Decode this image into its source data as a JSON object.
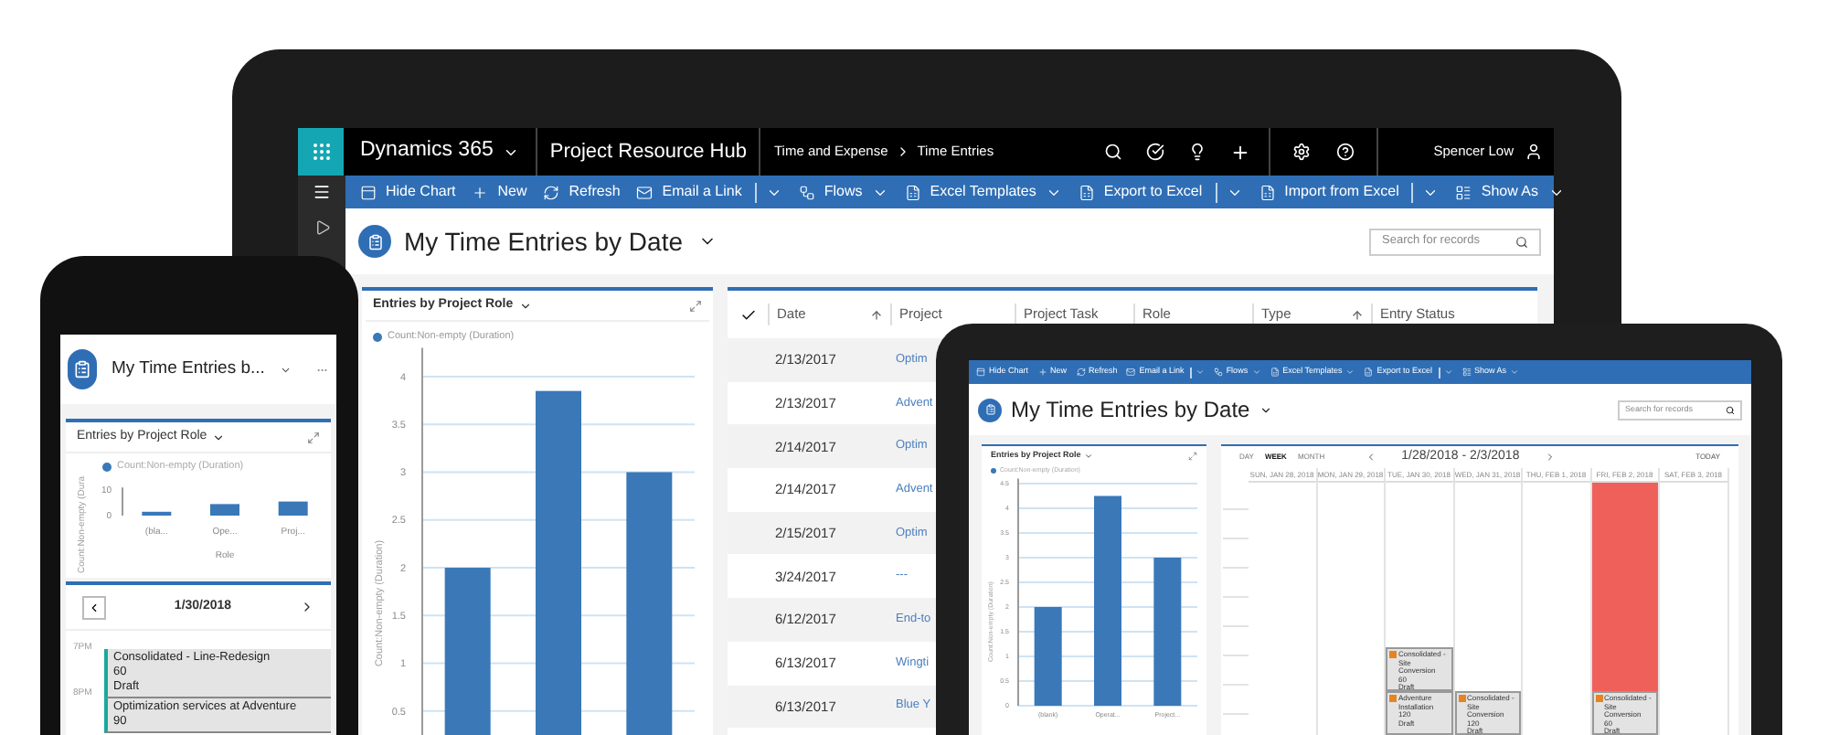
{
  "laptop": {
    "app_bar": {
      "app_name": "Dynamics 365",
      "app_area": "Project Resource Hub",
      "breadcrumb": [
        "Time and Expense",
        "Time Entries"
      ],
      "user": "Spencer Low"
    },
    "command_bar": [
      {
        "label": "Hide Chart",
        "kind": "button"
      },
      {
        "label": "New",
        "kind": "button"
      },
      {
        "label": "Refresh",
        "kind": "button"
      },
      {
        "label": "Email a Link",
        "kind": "split"
      },
      {
        "label": "Flows",
        "kind": "dropdown"
      },
      {
        "label": "Excel Templates",
        "kind": "dropdown"
      },
      {
        "label": "Export to Excel",
        "kind": "split"
      },
      {
        "label": "Import from Excel",
        "kind": "split"
      },
      {
        "label": "Show As",
        "kind": "dropdown"
      }
    ],
    "view": {
      "title": "My Time Entries by Date",
      "search_placeholder": "Search for records"
    },
    "chart": {
      "title": "Entries by Project Role",
      "chart_data": {
        "type": "bar",
        "grid": true,
        "ylabel": "Count:Non-empty (Duration)",
        "ylim": [
          0.25,
          4.3
        ],
        "yticks": [
          0.5,
          1,
          1.5,
          2,
          2.5,
          3,
          3.5,
          4
        ],
        "series": [
          {
            "name": "Count:Non-empty (Duration)",
            "color": "#3a78b8",
            "values": [
              2,
              3.85,
              3
            ]
          }
        ]
      }
    },
    "grid": {
      "columns": [
        {
          "label": "Date",
          "sorted": true
        },
        {
          "label": "Project",
          "sorted": false
        },
        {
          "label": "Project Task",
          "sorted": false
        },
        {
          "label": "Role",
          "sorted": false
        },
        {
          "label": "Type",
          "sorted": true
        },
        {
          "label": "Entry Status",
          "sorted": false
        }
      ],
      "rows": [
        {
          "date": "2/13/2017",
          "project": "Optim"
        },
        {
          "date": "2/13/2017",
          "project": "Advent"
        },
        {
          "date": "2/14/2017",
          "project": "Optim"
        },
        {
          "date": "2/14/2017",
          "project": "Advent"
        },
        {
          "date": "2/15/2017",
          "project": "Optim"
        },
        {
          "date": "3/24/2017",
          "project": "---"
        },
        {
          "date": "6/12/2017",
          "project": "End-to"
        },
        {
          "date": "6/13/2017",
          "project": "Wingti"
        },
        {
          "date": "6/13/2017",
          "project": "Blue Y"
        }
      ]
    }
  },
  "phone": {
    "title": "My Time Entries b...",
    "chart": {
      "title": "Entries by Project Role",
      "chart_data": {
        "type": "bar",
        "grid": false,
        "categories": [
          "(bla...",
          "Ope...",
          "Proj..."
        ],
        "xlabel": "Role",
        "ylabel": "Count:Non-empty (Dura",
        "ylim": [
          0,
          11
        ],
        "yticks": [
          0,
          10
        ],
        "series": [
          {
            "name": "Count:Non-empty (Duration)",
            "color": "#3a78b8",
            "values": [
              1.5,
              4.5,
              5.5
            ]
          }
        ]
      }
    },
    "calendar": {
      "date": "1/30/2018",
      "hours": [
        "7PM",
        "8PM"
      ],
      "entries": [
        {
          "title": "Consolidated - Line-Redesign",
          "duration": "60",
          "status": "Draft"
        },
        {
          "title": "Optimization services at Adventure",
          "duration": "90"
        }
      ]
    }
  },
  "tablet": {
    "command_bar": [
      {
        "label": "Hide Chart",
        "kind": "button"
      },
      {
        "label": "New",
        "kind": "button"
      },
      {
        "label": "Refresh",
        "kind": "button"
      },
      {
        "label": "Email a Link",
        "kind": "split"
      },
      {
        "label": "Flows",
        "kind": "dropdown"
      },
      {
        "label": "Excel Templates",
        "kind": "dropdown"
      },
      {
        "label": "Export to Excel",
        "kind": "split"
      },
      {
        "label": "Show As",
        "kind": "dropdown"
      }
    ],
    "view": {
      "title": "My Time Entries by Date",
      "search_placeholder": "Search for records"
    },
    "chart": {
      "title": "Entries by Project Role",
      "chart_data": {
        "type": "bar",
        "grid": true,
        "categories": [
          "(blank)",
          "Operat...",
          "Project..."
        ],
        "ylabel": "Count:Non-empty (Duration)",
        "ylim": [
          0,
          4.6
        ],
        "yticks": [
          0,
          0.5,
          1,
          1.5,
          2,
          2.5,
          3,
          3.5,
          4,
          4.5
        ],
        "series": [
          {
            "name": "Count:Non-empty (Duration)",
            "color": "#3a78b8",
            "values": [
              2,
              4.25,
              3
            ]
          }
        ]
      }
    },
    "calendar": {
      "views": [
        {
          "label": "DAY",
          "selected": false
        },
        {
          "label": "WEEK",
          "selected": true
        },
        {
          "label": "MONTH",
          "selected": false
        }
      ],
      "range": "1/28/2018 - 2/3/2018",
      "today": "TODAY",
      "days": [
        {
          "header": "SUN, JAN 28, 2018",
          "blocked": false
        },
        {
          "header": "MON, JAN 29, 2018",
          "blocked": false
        },
        {
          "header": "TUE, JAN 30, 2018",
          "blocked": false,
          "entries": [
            {
              "title": "Consolidated - Site Conversion",
              "duration": "60",
              "status": "Draft"
            },
            {
              "title": "Adventure Installation",
              "duration": "120",
              "status": "Draft"
            }
          ]
        },
        {
          "header": "WED, JAN 31, 2018",
          "blocked": false,
          "entries": [
            {
              "title": "Consolidated - Site Conversion",
              "duration": "120",
              "status": "Draft"
            }
          ]
        },
        {
          "header": "THU, FEB 1, 2018",
          "blocked": false
        },
        {
          "header": "FRI, FEB 2, 2018",
          "blocked": true,
          "entries": [
            {
              "title": "Consolidated - Site Conversion",
              "duration": "60",
              "status": "Draft"
            }
          ]
        },
        {
          "header": "SAT, FEB 3, 2018",
          "blocked": false
        }
      ]
    }
  }
}
